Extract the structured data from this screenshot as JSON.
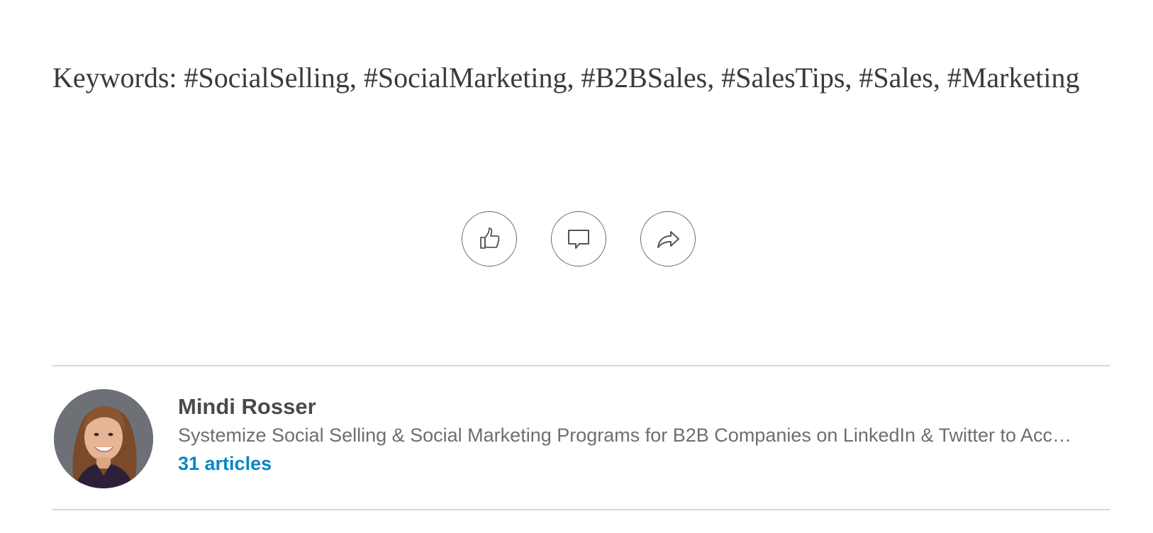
{
  "article": {
    "keywords_text": "Keywords: #SocialSelling, #SocialMarketing, #B2BSales, #SalesTips, #Sales, #Marketing"
  },
  "actions": [
    {
      "name": "like",
      "icon": "thumbs-up-icon"
    },
    {
      "name": "comment",
      "icon": "comment-bubble-icon"
    },
    {
      "name": "share",
      "icon": "share-arrow-icon"
    }
  ],
  "author": {
    "name": "Mindi Rosser",
    "headline": "Systemize Social Selling & Social Marketing Programs for B2B Companies on LinkedIn & Twitter to Acc…",
    "articles_label": "31 articles"
  },
  "colors": {
    "text": "#3a3a3a",
    "muted": "#6e6e6e",
    "link": "#0a84c6",
    "divider": "#d9d9d9"
  }
}
